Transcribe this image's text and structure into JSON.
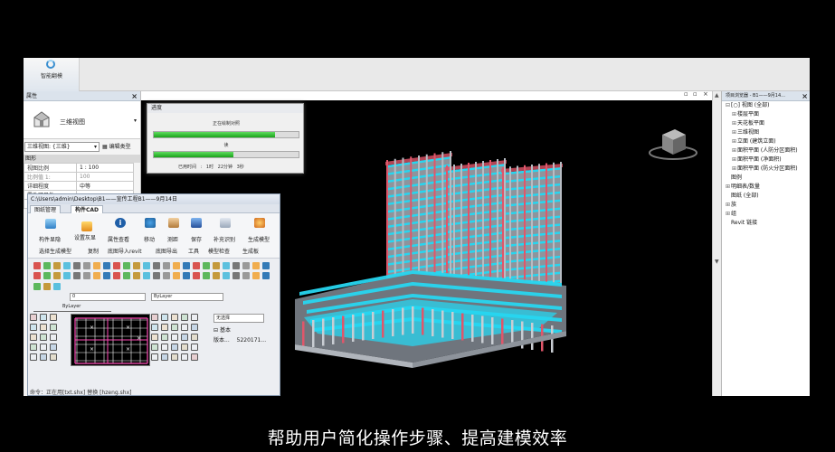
{
  "app": {
    "button_label": "智能翻模"
  },
  "properties": {
    "title": "属性",
    "type_name": "三维视图",
    "selector_value": "三维视图: {三维}",
    "edit_type_label": "编辑类型",
    "section_label": "图形",
    "rows": [
      {
        "key": "视图比例",
        "value": "1 : 100"
      },
      {
        "key": "比例值 1:",
        "value": "100"
      },
      {
        "key": "详细程度",
        "value": "中等"
      },
      {
        "key": "零件可见性",
        "value": ""
      },
      {
        "key": "可见性/...",
        "value": ""
      }
    ]
  },
  "progress": {
    "title": "进度",
    "label1": "正在绘制对照",
    "label2": "读",
    "stats": "已用时间 :  1时 22分钟 3秒",
    "bar1_fraction": 0.84,
    "bar2_fraction": 0.55
  },
  "cad": {
    "path": "C:\\Users\\admin\\Desktop\\B1——宣传工程B1——9月14日",
    "tabs": [
      "图纸管理",
      "构件CAD"
    ],
    "tools_row1": [
      "设置灰显",
      "属性查看",
      "移动",
      "测距",
      "保存",
      "补充识别"
    ],
    "tools_row1_left": "构件显隐",
    "tools_row1_right": "生成模型",
    "tools_row2": [
      "选择生成模型",
      "复制",
      "底图导入revit",
      "底图导出",
      "工具",
      "模型检查",
      "生成板"
    ],
    "layer_value": "0",
    "bylayer_1": "ByLayer",
    "bylayer_2": "ByLayer",
    "no_selection": "无选择",
    "basic_label": "基本",
    "version_key": "版本...",
    "version_value": "5220171...",
    "command": "命令：正在用[txt.shx] 替换 [hzeng.shx]"
  },
  "browser": {
    "title": "项目浏览器 - B1——9月14...",
    "nodes": [
      {
        "label": "[○] 视图 (全部)",
        "level": 0,
        "toggle": "⊟"
      },
      {
        "label": "楼层平面",
        "level": 1,
        "toggle": "⊞"
      },
      {
        "label": "天花板平面",
        "level": 1,
        "toggle": "⊞"
      },
      {
        "label": "三维视图",
        "level": 1,
        "toggle": "⊞"
      },
      {
        "label": "立面 (建筑立面)",
        "level": 1,
        "toggle": "⊞"
      },
      {
        "label": "面积平面 (人防分区面积)",
        "level": 1,
        "toggle": "⊞"
      },
      {
        "label": "面积平面 (净面积)",
        "level": 1,
        "toggle": "⊞"
      },
      {
        "label": "面积平面 (防火分区面积)",
        "level": 1,
        "toggle": "⊞"
      },
      {
        "label": "图例",
        "level": 0,
        "toggle": ""
      },
      {
        "label": "明细表/数量",
        "level": 0,
        "toggle": "⊞"
      },
      {
        "label": "图纸 (全部)",
        "level": 0,
        "toggle": ""
      },
      {
        "label": "族",
        "level": 0,
        "toggle": "⊞"
      },
      {
        "label": "组",
        "level": 0,
        "toggle": "⊞"
      },
      {
        "label": "Revit 链接",
        "level": 0,
        "toggle": ""
      }
    ]
  },
  "subtitle": "帮助用户简化操作步骤、提高建模效率",
  "colors": {
    "cyan": "#27d6f0",
    "red": "#e0566a",
    "grey": "#9aa0a8",
    "green": "#2ec22e"
  }
}
